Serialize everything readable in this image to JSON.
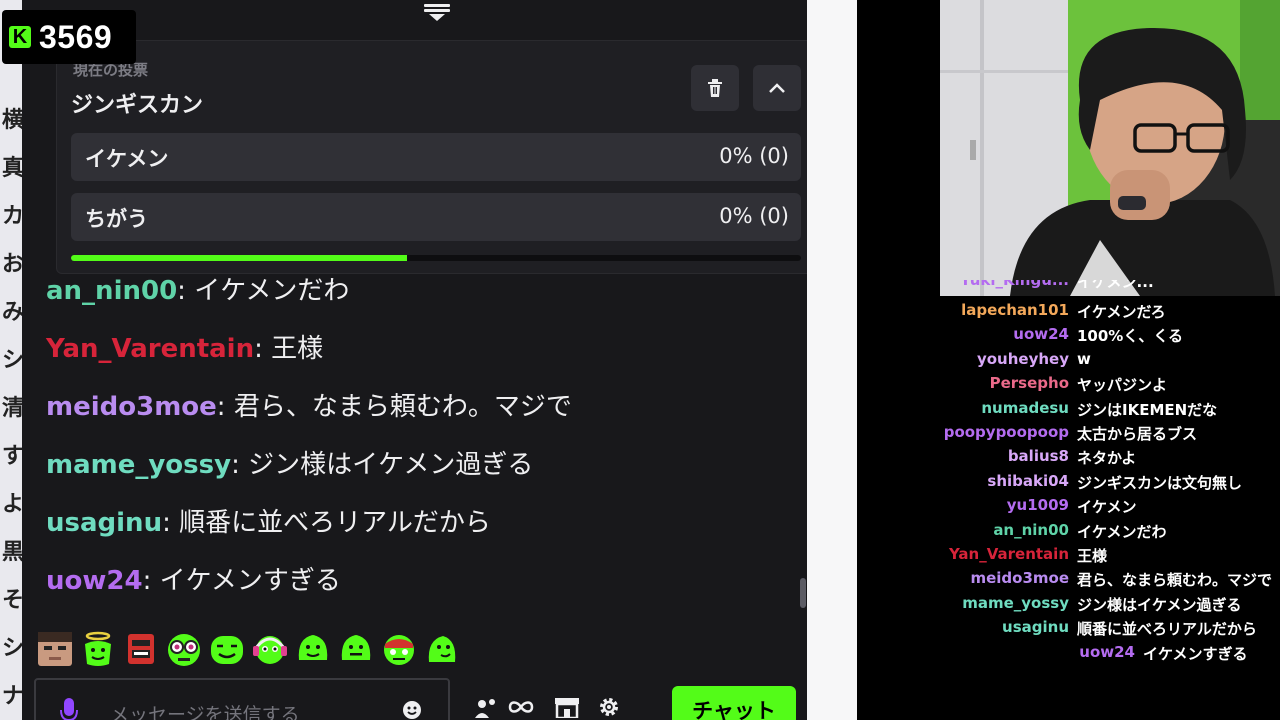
{
  "viewer_badge": {
    "count": "3569",
    "logo_letter": "K"
  },
  "background_strip": [
    "横",
    "真",
    "カ",
    "お",
    "み",
    "シ",
    "清",
    "す",
    "よ",
    "黒",
    "そ",
    "シ",
    "ナ"
  ],
  "poll": {
    "label": "現在の投票",
    "title": "ジンギスカン",
    "options": [
      {
        "label": "イケメン",
        "result": "0% (0)"
      },
      {
        "label": "ちがう",
        "result": "0% (0)"
      }
    ],
    "time_remaining_fraction": 0.46
  },
  "chat": {
    "messages": [
      {
        "user": "an_nin00",
        "color": "#5fd3a8",
        "text": "イケメンだわ"
      },
      {
        "user": "Yan_Varentain",
        "color": "#d7243a",
        "text": "王様"
      },
      {
        "user": "meido3moe",
        "color": "#b98cf0",
        "text": "君ら、なまら頼むわ。マジで"
      },
      {
        "user": "mame_yossy",
        "color": "#6fdcc0",
        "text": "ジン様はイケメン過ぎる"
      },
      {
        "user": "usaginu",
        "color": "#6fdcc0",
        "text": "順番に並べろリアルだから"
      },
      {
        "user": "uow24",
        "color": "#b46cf0",
        "text": "イケメンすぎる"
      }
    ],
    "input_placeholder": "メッセージを送信する",
    "send_button": "チャット"
  },
  "overlay_chat": {
    "cut_line": {
      "user": "Yuki_Kingu...",
      "text": "イケメン..."
    },
    "messages": [
      {
        "user": "lapechan101",
        "color": "#f3a85a",
        "text": "イケメンだろ"
      },
      {
        "user": "uow24",
        "color": "#b46cf0",
        "text": "100%く、くる"
      },
      {
        "user": "youheyhey",
        "color": "#d8a8f8",
        "text": "w"
      },
      {
        "user": "Persepho",
        "color": "#ea6a8a",
        "text": "ヤッパジンよ"
      },
      {
        "user": "numadesu",
        "color": "#6fdcc0",
        "text": "ジンはIKEMENだな"
      },
      {
        "user": "poopypoopoop",
        "color": "#b46cf0",
        "text": "太古から居るブス"
      },
      {
        "user": "balius8",
        "color": "#d8a8f8",
        "text": "ネタかよ"
      },
      {
        "user": "shibaki04",
        "color": "#d8a8f8",
        "text": "ジンギスカンは文句無し"
      },
      {
        "user": "yu1009",
        "color": "#b46cf0",
        "text": "イケメン"
      },
      {
        "user": "an_nin00",
        "color": "#5fd3a8",
        "text": "イケメンだわ"
      },
      {
        "user": "Yan_Varentain",
        "color": "#d7243a",
        "text": "王様"
      },
      {
        "user": "meido3moe",
        "color": "#b98cf0",
        "text": "君ら、なまら頼むわ。マジで"
      },
      {
        "user": "mame_yossy",
        "color": "#6fdcc0",
        "text": "ジン様はイケメン過ぎる"
      },
      {
        "user": "usaginu",
        "color": "#6fdcc0",
        "text": "順番に並べろリアルだから"
      },
      {
        "user": "uow24",
        "color": "#b46cf0",
        "text": "イケメンすぎる"
      }
    ]
  },
  "colors": {
    "accent": "#53fc18",
    "panel": "#18181b",
    "card": "#1f1f23"
  },
  "icons": [
    "drag-handle-icon",
    "trash-icon",
    "chevron-up-icon",
    "mic-icon",
    "emote-picker-icon",
    "people-icon",
    "infinity-icon",
    "store-icon",
    "gear-icon"
  ]
}
